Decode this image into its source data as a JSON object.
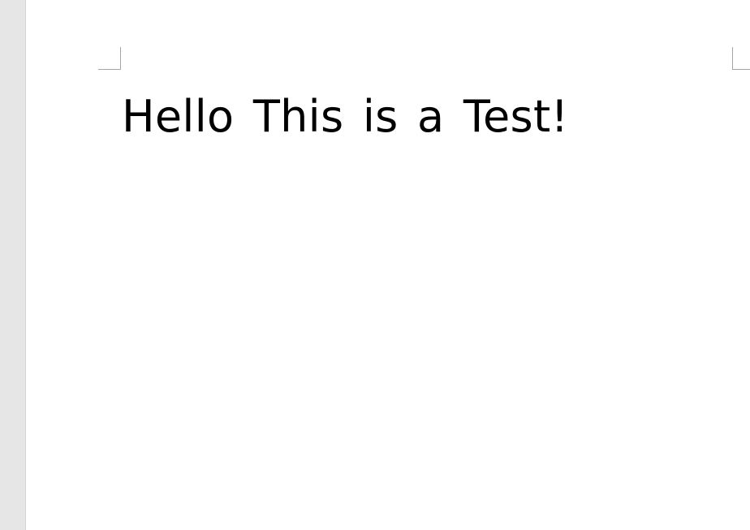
{
  "document": {
    "body_text": "Hello This is a Test!"
  }
}
